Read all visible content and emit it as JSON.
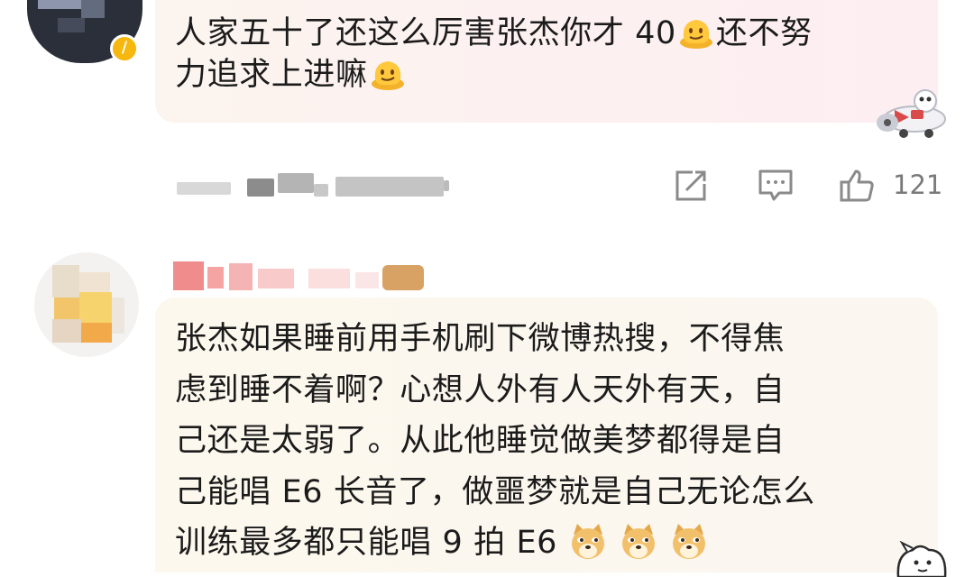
{
  "comments": [
    {
      "text_line1": "人家五十了还这么厉害张杰你才 40",
      "text_after_emoji1": "还不努",
      "text_line2": "力追求上进嘛",
      "emojis": [
        "melting-face-emoji",
        "melting-face-emoji"
      ],
      "like_count": "121",
      "meta_blurred": true
    },
    {
      "username_blurred": true,
      "text_line1": "张杰如果睡前用手机刷下微博热搜，不得焦",
      "text_line2": "虑到睡不着啊？心想人外有人天外有天，自",
      "text_line3": "己还是太弱了。从此他睡觉做美梦都得是自",
      "text_line4": "己能唱 E6 长音了，做噩梦就是自己无论怎么",
      "text_line5": "训练最多都只能唱 9 拍 E6",
      "emojis": [
        "doge-emoji",
        "doge-emoji",
        "doge-emoji"
      ]
    }
  ],
  "icons": {
    "share": "share-icon",
    "comment": "comment-icon",
    "like": "thumbs-up-icon",
    "verified": "verified-badge-icon"
  },
  "colors": {
    "verified_badge": "#f6b70f",
    "icon_gray": "#8a8a8a",
    "bubble1_bg": "#fbf2f0",
    "bubble2_bg": "#fbf7ee"
  }
}
